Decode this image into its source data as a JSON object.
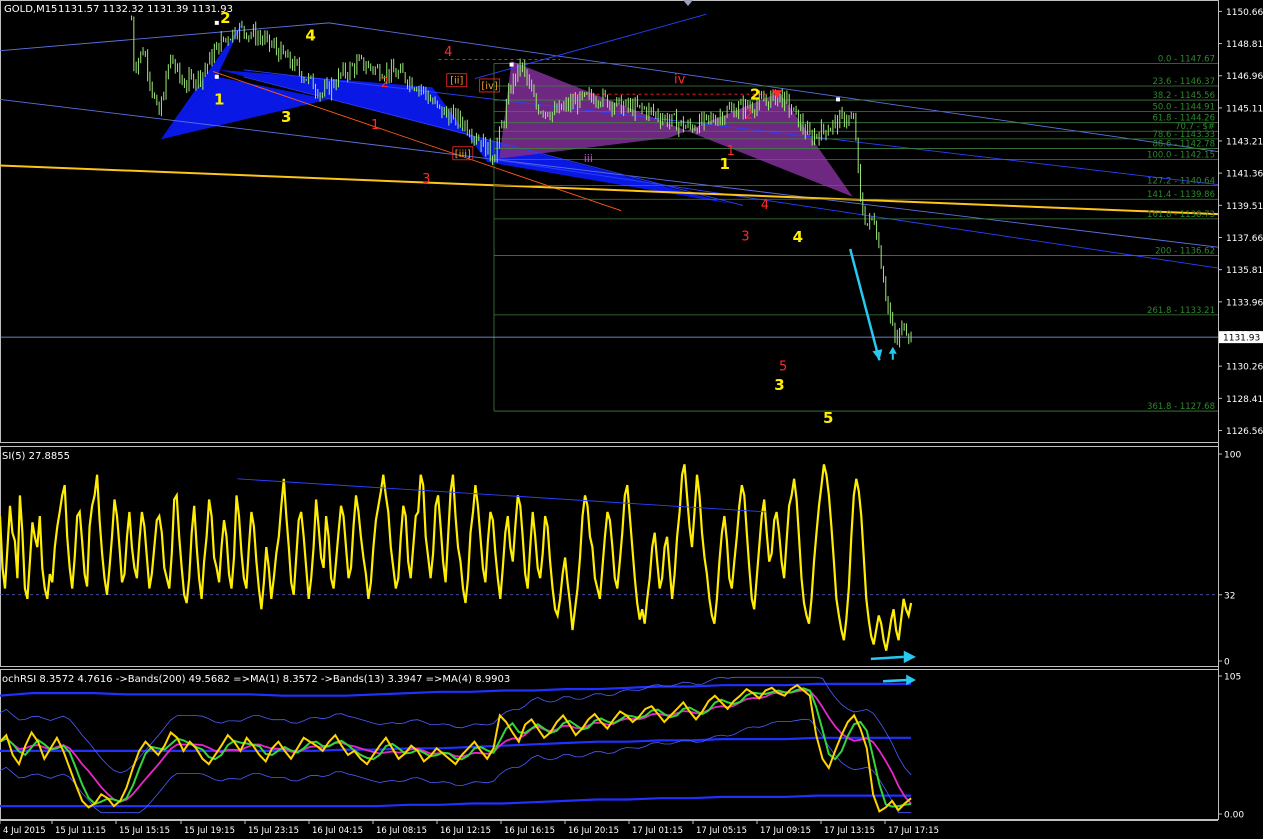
{
  "colors": {
    "background": "#000000",
    "frame": "#c0c0c0",
    "bull": "#9ee67a",
    "price_line": "#8fa7ff",
    "fib": "#3f7f3f",
    "fib_text": "#2c8a2c",
    "wave_yellow": "#ffee00",
    "wave_red": "#ff2a2a",
    "blue_fill": "#0a18e6",
    "purple_fill": "#7a2c90",
    "trend_blue": "#2a40ff",
    "trend_light": "#5c72e0",
    "support_yellow": "#ffc41a",
    "orange_line": "#ff5a1a",
    "rsi_line": "#ffee00",
    "cyan_arrow": "#29c8f0",
    "stoch_k": "#ffd400",
    "stoch_signal": "#33d63a",
    "stoch_ma": "#e628c8",
    "band_blue": "#2130ff",
    "thin_band": "#4c5cff"
  },
  "header": {
    "symbol": "GOLD,M15",
    "ohlc": "1131.57 1132.32 1131.39 1131.93"
  },
  "price_panel": {
    "ylim": [
      1125.9,
      1151.2
    ],
    "last_price": "1131.93",
    "y_ticks": [
      "1150.66",
      "1148.81",
      "1146.96",
      "1145.11",
      "1143.21",
      "1141.36",
      "1139.51",
      "1137.66",
      "1135.81",
      "1133.96",
      "1132.11",
      "1130.26",
      "1128.41",
      "1126.56"
    ],
    "fib_levels": [
      {
        "label": "0.0 - 1147.67",
        "value": 1147.67
      },
      {
        "label": "23.6 - 1146.37",
        "value": 1146.37
      },
      {
        "label": "38.2 - 1145.56",
        "value": 1145.56
      },
      {
        "label": "50.0 - 1144.91",
        "value": 1144.91
      },
      {
        "label": "61.8 - 1144.26",
        "value": 1144.26
      },
      {
        "label": "70.7 - $#",
        "value": 1143.77
      },
      {
        "label": "78.6 - 1143.33",
        "value": 1143.33
      },
      {
        "label": "88.6 - 1142.78",
        "value": 1142.78
      },
      {
        "label": "100.0 - 1142.15",
        "value": 1142.15
      },
      {
        "label": "127.2 - 1140.64",
        "value": 1140.64
      },
      {
        "label": "141.4 - 1139.86",
        "value": 1139.86
      },
      {
        "label": "161.8 - 1138.73",
        "value": 1138.73
      },
      {
        "label": "200 - 1136.62",
        "value": 1136.62
      },
      {
        "label": "261.8 - 1133.21",
        "value": 1133.21
      },
      {
        "label": "361.8 - 1127.68",
        "value": 1127.68
      }
    ],
    "wave_labels_yellow": [
      {
        "text": "2",
        "t": 0.185,
        "price": 1150.0
      },
      {
        "text": "1",
        "t": 0.18,
        "price": 1145.3
      },
      {
        "text": "4",
        "t": 0.255,
        "price": 1149.0
      },
      {
        "text": "3",
        "t": 0.235,
        "price": 1144.3
      },
      {
        "text": "2",
        "t": 0.62,
        "price": 1145.6
      },
      {
        "text": "1",
        "t": 0.595,
        "price": 1141.6
      },
      {
        "text": "4",
        "t": 0.655,
        "price": 1137.4
      },
      {
        "text": "3",
        "t": 0.64,
        "price": 1128.9
      },
      {
        "text": "5",
        "t": 0.68,
        "price": 1127.0
      }
    ],
    "wave_labels_red": [
      {
        "text": "4",
        "t": 0.368,
        "price": 1148.1
      },
      {
        "text": "2",
        "t": 0.316,
        "price": 1146.3
      },
      {
        "text": "1",
        "t": 0.308,
        "price": 1143.9
      },
      {
        "text": "3",
        "t": 0.35,
        "price": 1140.8
      },
      {
        "text": "2",
        "t": 0.615,
        "price": 1144.5
      },
      {
        "text": "1",
        "t": 0.6,
        "price": 1142.4
      },
      {
        "text": "4",
        "t": 0.628,
        "price": 1139.3
      },
      {
        "text": "3",
        "t": 0.612,
        "price": 1137.5
      },
      {
        "text": "5",
        "t": 0.643,
        "price": 1130.0
      },
      {
        "text": "iv",
        "t": 0.558,
        "price": 1146.5
      }
    ],
    "wave_labels_boxed": [
      {
        "text": "[ii]",
        "t": 0.375,
        "price": 1146.5
      },
      {
        "text": "[iv]",
        "t": 0.402,
        "price": 1146.2
      },
      {
        "text": "[iii]",
        "t": 0.38,
        "price": 1142.3
      }
    ],
    "wave_labels_purple": [
      {
        "text": "iii",
        "t": 0.483,
        "price": 1142.0
      }
    ]
  },
  "rsi_panel": {
    "title": "SI(5) 27.8855",
    "ylim": [
      0,
      100
    ],
    "ticks": [
      "100",
      "32",
      "0"
    ],
    "level": 32,
    "values": [
      70,
      45,
      35,
      55,
      75,
      62,
      58,
      40,
      80,
      62,
      35,
      30,
      48,
      67,
      60,
      55,
      70,
      45,
      35,
      30,
      42,
      38,
      55,
      65,
      72,
      80,
      85,
      60,
      45,
      35,
      50,
      70,
      72,
      58,
      42,
      36,
      65,
      75,
      80,
      90,
      68,
      52,
      40,
      32,
      45,
      60,
      78,
      70,
      55,
      38,
      42,
      60,
      72,
      55,
      45,
      40,
      58,
      72,
      65,
      50,
      35,
      42,
      55,
      68,
      70,
      62,
      45,
      40,
      35,
      52,
      78,
      80,
      60,
      45,
      32,
      28,
      40,
      62,
      75,
      55,
      40,
      30,
      48,
      60,
      78,
      70,
      50,
      45,
      38,
      55,
      68,
      60,
      42,
      35,
      50,
      80,
      70,
      52,
      40,
      35,
      55,
      72,
      65,
      48,
      35,
      25,
      38,
      55,
      45,
      30,
      40,
      52,
      60,
      75,
      88,
      70,
      55,
      38,
      32,
      50,
      68,
      72,
      60,
      45,
      30,
      40,
      55,
      78,
      65,
      50,
      45,
      70,
      60,
      40,
      35,
      48,
      62,
      75,
      70,
      55,
      40,
      45,
      65,
      80,
      72,
      60,
      50,
      42,
      30,
      38,
      55,
      68,
      75,
      82,
      90,
      80,
      72,
      55,
      45,
      35,
      40,
      60,
      75,
      70,
      48,
      40,
      55,
      70,
      72,
      90,
      85,
      60,
      50,
      40,
      52,
      75,
      80,
      65,
      48,
      38,
      60,
      82,
      90,
      70,
      55,
      48,
      35,
      28,
      40,
      62,
      72,
      85,
      75,
      60,
      45,
      38,
      58,
      72,
      68,
      52,
      40,
      30,
      45,
      62,
      70,
      55,
      48,
      65,
      80,
      75,
      60,
      42,
      35,
      55,
      72,
      60,
      45,
      40,
      52,
      70,
      65,
      48,
      35,
      25,
      22,
      30,
      42,
      50,
      38,
      28,
      15,
      25,
      35,
      50,
      70,
      80,
      75,
      60,
      55,
      40,
      35,
      30,
      45,
      60,
      72,
      68,
      55,
      40,
      35,
      48,
      62,
      80,
      85,
      70,
      55,
      40,
      28,
      20,
      25,
      18,
      30,
      40,
      55,
      62,
      48,
      35,
      40,
      55,
      60,
      45,
      30,
      42,
      60,
      72,
      90,
      95,
      80,
      65,
      55,
      72,
      90,
      80,
      62,
      50,
      42,
      30,
      22,
      18,
      30,
      48,
      62,
      70,
      58,
      40,
      35,
      48,
      60,
      75,
      85,
      80,
      62,
      45,
      30,
      25,
      40,
      55,
      70,
      78,
      62,
      48,
      52,
      68,
      72,
      62,
      48,
      40,
      58,
      75,
      80,
      88,
      78,
      60,
      40,
      28,
      22,
      18,
      30,
      48,
      62,
      75,
      85,
      95,
      90,
      80,
      65,
      48,
      30,
      22,
      15,
      10,
      20,
      35,
      60,
      80,
      88,
      82,
      70,
      50,
      30,
      20,
      12,
      8,
      15,
      22,
      18,
      10,
      5,
      12,
      20,
      25,
      15,
      10,
      20,
      30,
      25,
      22,
      28
    ]
  },
  "stoch_panel": {
    "title": "ochRSI 8.3572 4.7616  ->Bands(200) 49.5682  =>MA(1) 8.3572  ->Bands(13) 3.3947  =>MA(4) 8.9903",
    "ylim": [
      0,
      105
    ],
    "ticks": [
      "105",
      "0.00"
    ],
    "upper_band": [
      90,
      92,
      92,
      92,
      91,
      91,
      91,
      91,
      91,
      90,
      90,
      90,
      91,
      92,
      93,
      93,
      94,
      94,
      95,
      95,
      96,
      97,
      97,
      98,
      98,
      98,
      99,
      99,
      99,
      99
    ],
    "mid_band": [
      48,
      48,
      48,
      48,
      48,
      48,
      48,
      48,
      48,
      48,
      48,
      49,
      49,
      50,
      50,
      51,
      52,
      53,
      54,
      55,
      55,
      56,
      56,
      57,
      57,
      57,
      58,
      58,
      58,
      58
    ],
    "lower_band": [
      6,
      6,
      6,
      6,
      6,
      6,
      6,
      6,
      6,
      6,
      6,
      6,
      6,
      7,
      7,
      8,
      8,
      9,
      10,
      11,
      11,
      12,
      12,
      13,
      13,
      13,
      14,
      14,
      14,
      14
    ],
    "k_values": [
      55,
      60,
      45,
      38,
      52,
      62,
      55,
      42,
      50,
      58,
      48,
      35,
      22,
      10,
      5,
      8,
      15,
      12,
      6,
      10,
      20,
      35,
      48,
      55,
      50,
      45,
      52,
      62,
      58,
      48,
      55,
      50,
      42,
      38,
      45,
      52,
      60,
      55,
      48,
      58,
      52,
      45,
      40,
      50,
      55,
      48,
      42,
      50,
      58,
      55,
      52,
      48,
      55,
      60,
      52,
      45,
      48,
      42,
      38,
      45,
      52,
      58,
      50,
      42,
      46,
      52,
      48,
      40,
      44,
      50,
      46,
      42,
      38,
      45,
      50,
      55,
      48,
      42,
      50,
      75,
      70,
      62,
      55,
      68,
      72,
      65,
      58,
      62,
      70,
      75,
      68,
      60,
      65,
      72,
      76,
      70,
      65,
      72,
      78,
      75,
      70,
      74,
      80,
      82,
      76,
      70,
      75,
      80,
      85,
      78,
      72,
      78,
      86,
      90,
      85,
      80,
      86,
      90,
      95,
      92,
      88,
      94,
      96,
      92,
      90,
      95,
      98,
      94,
      90,
      60,
      42,
      35,
      48,
      60,
      70,
      75,
      65,
      50,
      15,
      2,
      5,
      10,
      3,
      8,
      12
    ],
    "k_points": 144
  },
  "x_axis": {
    "labels": [
      "4 Jul 2015",
      "15 Jul 11:15",
      "15 Jul 15:15",
      "15 Jul 19:15",
      "15 Jul 23:15",
      "16 Jul 04:15",
      "16 Jul 08:15",
      "16 Jul 12:15",
      "16 Jul 16:15",
      "16 Jul 20:15",
      "17 Jul 01:15",
      "17 Jul 05:15",
      "17 Jul 09:15",
      "17 Jul 13:15",
      "17 Jul 17:15"
    ]
  }
}
